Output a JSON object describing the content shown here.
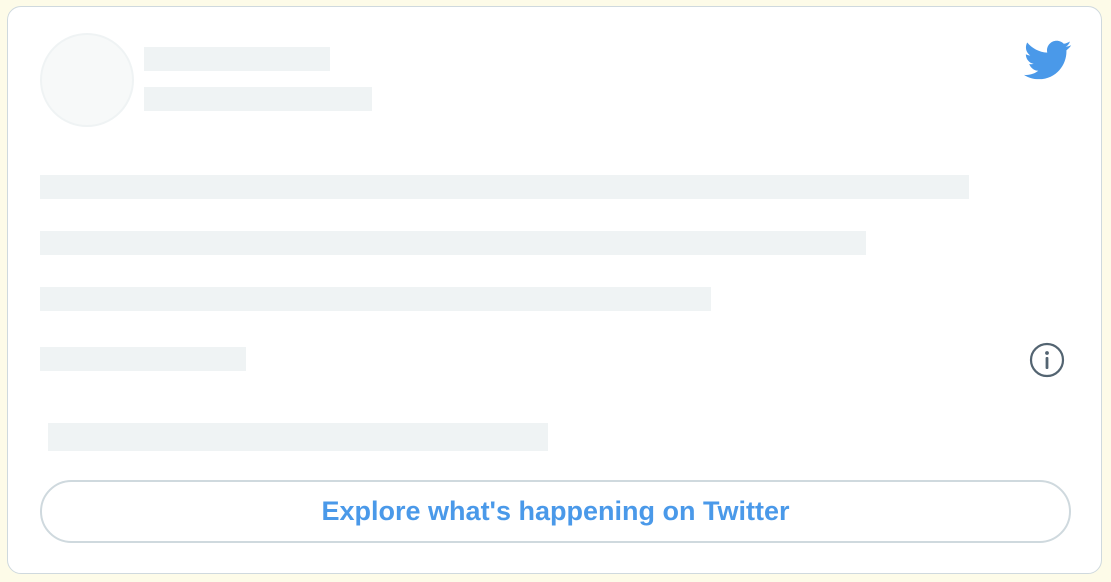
{
  "brand": {
    "icon": "twitter-bird-icon",
    "color": "#4a99e9"
  },
  "info": {
    "icon": "info-icon",
    "color": "#536471"
  },
  "skeleton": {
    "color": "#eff3f4"
  },
  "cta": {
    "label": "Explore what's happening on Twitter"
  }
}
